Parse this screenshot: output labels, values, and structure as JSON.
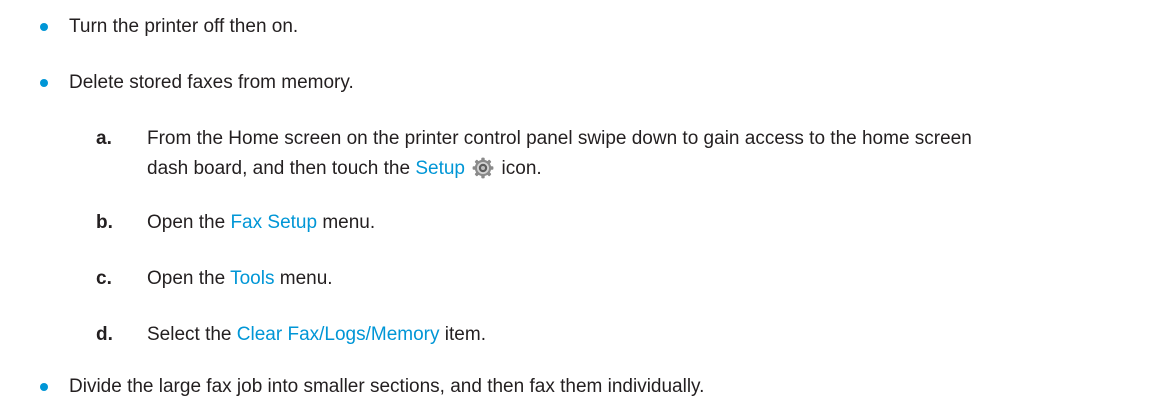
{
  "items": {
    "bullet1": "Turn the printer off then on.",
    "bullet2": "Delete stored faxes from memory.",
    "bullet3": "Divide the large fax job into smaller sections, and then fax them individually."
  },
  "steps": {
    "a": {
      "letter": "a.",
      "text1": "From the Home screen on the printer control panel swipe down to gain access to the home screen",
      "text2": "dash board, and then touch the ",
      "link": "Setup",
      "icon": "gear-icon",
      "text3": " icon."
    },
    "b": {
      "letter": "b.",
      "pre": "Open the ",
      "link": "Fax Setup",
      "post": " menu."
    },
    "c": {
      "letter": "c.",
      "pre": "Open the ",
      "link": "Tools",
      "post": " menu."
    },
    "d": {
      "letter": "d.",
      "pre": "Select the ",
      "link": "Clear Fax/Logs/Memory",
      "post": " item."
    }
  },
  "colors": {
    "link": "#0096d6",
    "bullet": "#0096d6",
    "text": "#231f20"
  }
}
